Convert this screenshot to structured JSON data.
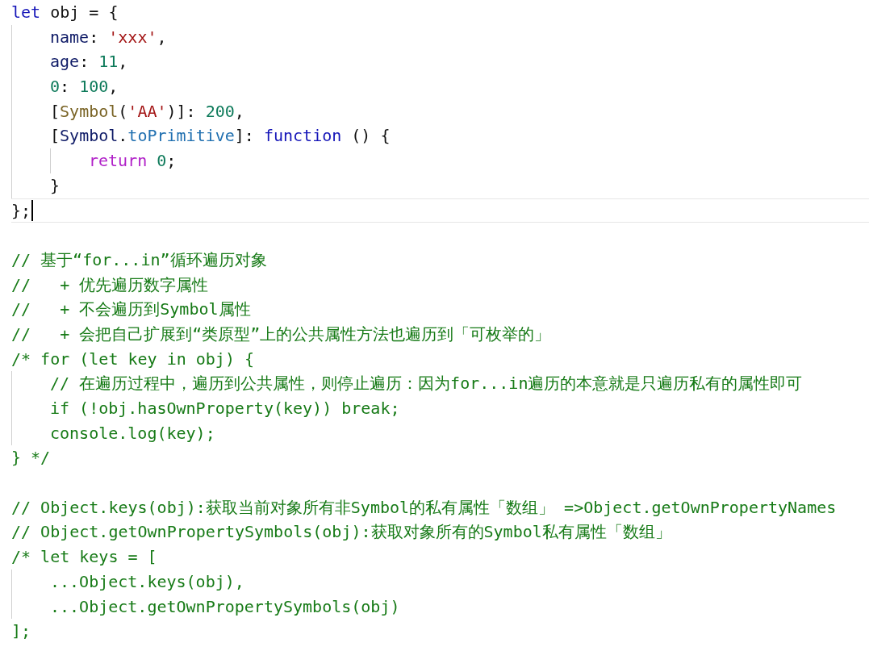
{
  "editor": {
    "sections": [
      {
        "lines": [
          {
            "current": false,
            "tokens": [
              {
                "text": "let",
                "kind": "keyword"
              },
              {
                "text": " obj = {",
                "kind": "plain"
              }
            ],
            "children": [
              {
                "current": false,
                "tokens": [
                  {
                    "text": "name",
                    "kind": "property"
                  },
                  {
                    "text": ": ",
                    "kind": "plain"
                  },
                  {
                    "text": "'xxx'",
                    "kind": "string"
                  },
                  {
                    "text": ",",
                    "kind": "plain"
                  }
                ]
              },
              {
                "current": false,
                "tokens": [
                  {
                    "text": "age",
                    "kind": "property"
                  },
                  {
                    "text": ": ",
                    "kind": "plain"
                  },
                  {
                    "text": "11",
                    "kind": "number"
                  },
                  {
                    "text": ",",
                    "kind": "plain"
                  }
                ]
              },
              {
                "current": false,
                "tokens": [
                  {
                    "text": "0",
                    "kind": "number"
                  },
                  {
                    "text": ": ",
                    "kind": "plain"
                  },
                  {
                    "text": "100",
                    "kind": "number"
                  },
                  {
                    "text": ",",
                    "kind": "plain"
                  }
                ]
              },
              {
                "current": false,
                "tokens": [
                  {
                    "text": "[",
                    "kind": "plain"
                  },
                  {
                    "text": "Symbol",
                    "kind": "function"
                  },
                  {
                    "text": "(",
                    "kind": "plain"
                  },
                  {
                    "text": "'AA'",
                    "kind": "string"
                  },
                  {
                    "text": ")]: ",
                    "kind": "plain"
                  },
                  {
                    "text": "200",
                    "kind": "number"
                  },
                  {
                    "text": ",",
                    "kind": "plain"
                  }
                ]
              },
              {
                "current": false,
                "tokens": [
                  {
                    "text": "[",
                    "kind": "plain"
                  },
                  {
                    "text": "Symbol",
                    "kind": "property"
                  },
                  {
                    "text": ".",
                    "kind": "plain"
                  },
                  {
                    "text": "toPrimitive",
                    "kind": "member"
                  },
                  {
                    "text": "]: ",
                    "kind": "plain"
                  },
                  {
                    "text": "function",
                    "kind": "keyword"
                  },
                  {
                    "text": " () {",
                    "kind": "plain"
                  }
                ],
                "children": [
                  {
                    "current": false,
                    "tokens": [
                      {
                        "text": "return",
                        "kind": "control"
                      },
                      {
                        "text": " 0",
                        "kind": "number"
                      },
                      {
                        "text": ";",
                        "kind": "plain"
                      }
                    ]
                  }
                ]
              },
              {
                "current": false,
                "tokens": [
                  {
                    "text": "}",
                    "kind": "plain"
                  }
                ]
              }
            ]
          },
          {
            "current": true,
            "tokens": [
              {
                "text": "};",
                "kind": "plain"
              }
            ]
          }
        ]
      },
      {
        "lines": [
          {
            "current": false,
            "tokens": [
              {
                "text": "// 基于“for...in”循环遍历对象",
                "kind": "comment"
              }
            ]
          },
          {
            "current": false,
            "tokens": [
              {
                "text": "//   + 优先遍历数字属性",
                "kind": "comment"
              }
            ]
          },
          {
            "current": false,
            "tokens": [
              {
                "text": "//   + 不会遍历到Symbol属性",
                "kind": "comment"
              }
            ]
          },
          {
            "current": false,
            "tokens": [
              {
                "text": "//   + 会把自己扩展到“类原型”上的公共属性方法也遍历到「可枚举的」",
                "kind": "comment"
              }
            ]
          },
          {
            "current": false,
            "tokens": [
              {
                "text": "/* for (let key in obj) {",
                "kind": "comment"
              }
            ],
            "children": [
              {
                "current": false,
                "tokens": [
                  {
                    "text": "// 在遍历过程中，遍历到公共属性，则停止遍历：因为for...in遍历的本意就是只遍历私有的属性即可",
                    "kind": "comment"
                  }
                ]
              },
              {
                "current": false,
                "tokens": [
                  {
                    "text": "if (!obj.hasOwnProperty(key)) break;",
                    "kind": "comment"
                  }
                ]
              },
              {
                "current": false,
                "tokens": [
                  {
                    "text": "console.log(key);",
                    "kind": "comment"
                  }
                ]
              }
            ]
          },
          {
            "current": false,
            "tokens": [
              {
                "text": "} */",
                "kind": "comment"
              }
            ]
          }
        ]
      },
      {
        "lines": [
          {
            "current": false,
            "tokens": [
              {
                "text": "// Object.keys(obj):获取当前对象所有非Symbol的私有属性「数组」 =>Object.getOwnPropertyNames",
                "kind": "comment"
              }
            ]
          },
          {
            "current": false,
            "tokens": [
              {
                "text": "// Object.getOwnPropertySymbols(obj):获取对象所有的Symbol私有属性「数组」",
                "kind": "comment"
              }
            ]
          },
          {
            "current": false,
            "tokens": [
              {
                "text": "/* let keys = [",
                "kind": "comment"
              }
            ],
            "children": [
              {
                "current": false,
                "tokens": [
                  {
                    "text": "...Object.keys(obj),",
                    "kind": "comment"
                  }
                ]
              },
              {
                "current": false,
                "tokens": [
                  {
                    "text": "...Object.getOwnPropertySymbols(obj)",
                    "kind": "comment"
                  }
                ]
              }
            ]
          },
          {
            "current": false,
            "tokens": [
              {
                "text": "];",
                "kind": "comment"
              }
            ]
          }
        ]
      }
    ]
  }
}
